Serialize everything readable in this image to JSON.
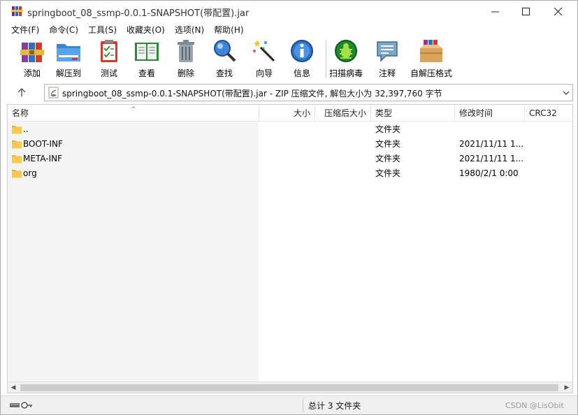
{
  "window": {
    "title": "springboot_08_ssmp-0.0.1-SNAPSHOT(带配置).jar",
    "app_icon": "winrar-books-icon"
  },
  "menu": [
    "文件(F)",
    "命令(C)",
    "工具(S)",
    "收藏夹(O)",
    "选项(N)",
    "帮助(H)"
  ],
  "toolbar": [
    {
      "label": "添加",
      "icon": "add-archive-icon"
    },
    {
      "label": "解压到",
      "icon": "extract-folder-icon"
    },
    {
      "label": "测试",
      "icon": "test-clipboard-icon"
    },
    {
      "label": "查看",
      "icon": "view-book-icon"
    },
    {
      "label": "删除",
      "icon": "trash-icon"
    },
    {
      "label": "查找",
      "icon": "magnifier-icon"
    },
    {
      "label": "向导",
      "icon": "wizard-wand-icon"
    },
    {
      "label": "信息",
      "icon": "info-icon"
    },
    {
      "label": "扫描病毒",
      "icon": "virus-scan-icon"
    },
    {
      "label": "注释",
      "icon": "comment-icon"
    },
    {
      "label": "自解压格式",
      "icon": "sfx-box-icon"
    }
  ],
  "address": {
    "text": "springboot_08_ssmp-0.0.1-SNAPSHOT(带配置).jar - ZIP 压缩文件, 解包大小为 32,397,760 字节"
  },
  "columns": {
    "name": "名称",
    "size": "大小",
    "packed": "压缩后大小",
    "type": "类型",
    "modified": "修改时间",
    "crc": "CRC32"
  },
  "rows": [
    {
      "name": "..",
      "type": "文件夹",
      "modified": ""
    },
    {
      "name": "BOOT-INF",
      "type": "文件夹",
      "modified": "2021/11/11 1..."
    },
    {
      "name": "META-INF",
      "type": "文件夹",
      "modified": "2021/11/11 1..."
    },
    {
      "name": "org",
      "type": "文件夹",
      "modified": "1980/2/1 0:00"
    }
  ],
  "status": {
    "summary": "总计 3 文件夹",
    "watermark": "CSDN @LisObit"
  },
  "colors": {
    "folder": "#f8c94b",
    "name_pane": "#f4f4f4",
    "statusbar": "#f0f0f0"
  }
}
